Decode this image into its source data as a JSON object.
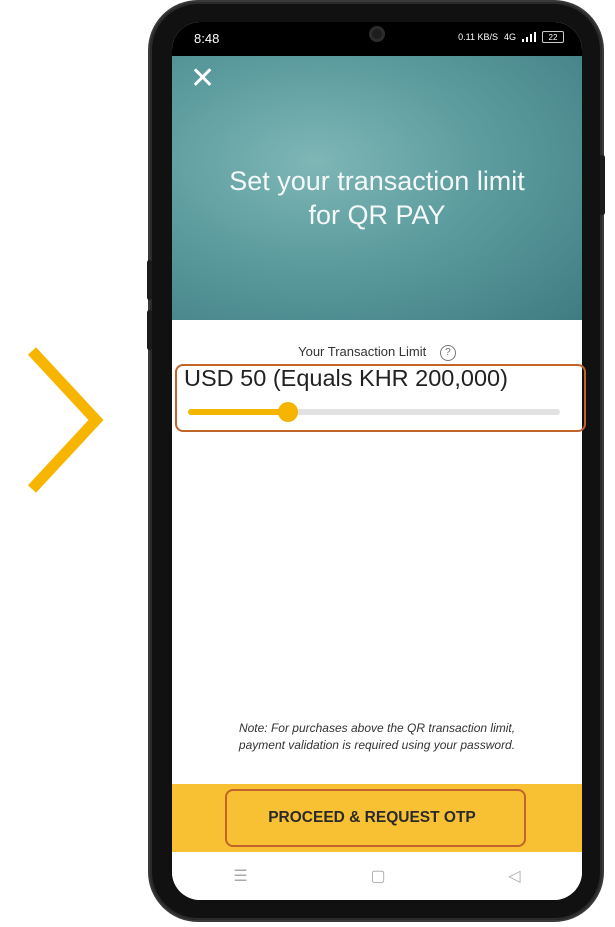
{
  "status_bar": {
    "time": "8:48",
    "network_speed": "0.11 KB/S",
    "signal_label": "4G",
    "battery_level": "22"
  },
  "header": {
    "close_symbol": "✕",
    "title_line1": "Set your transaction limit",
    "title_line2": "for QR PAY"
  },
  "limit": {
    "label": "Your Transaction Limit",
    "help_symbol": "?",
    "value_text": "USD 50 (Equals KHR 200,000)",
    "slider_fraction": 0.27
  },
  "note": {
    "line1": "Note: For purchases above the QR transaction limit,",
    "line2": "payment validation is required using your password."
  },
  "cta": {
    "label": "PROCEED & REQUEST OTP"
  },
  "nav": {
    "menu_symbol": "☰",
    "home_symbol": "▢",
    "back_symbol": "◁"
  },
  "colors": {
    "accent_yellow": "#f8c133",
    "slider_yellow": "#f4b400",
    "highlight_orange": "#c0642b",
    "chevron_yellow": "#f7b500",
    "hero_teal": "#5c9c9e"
  }
}
